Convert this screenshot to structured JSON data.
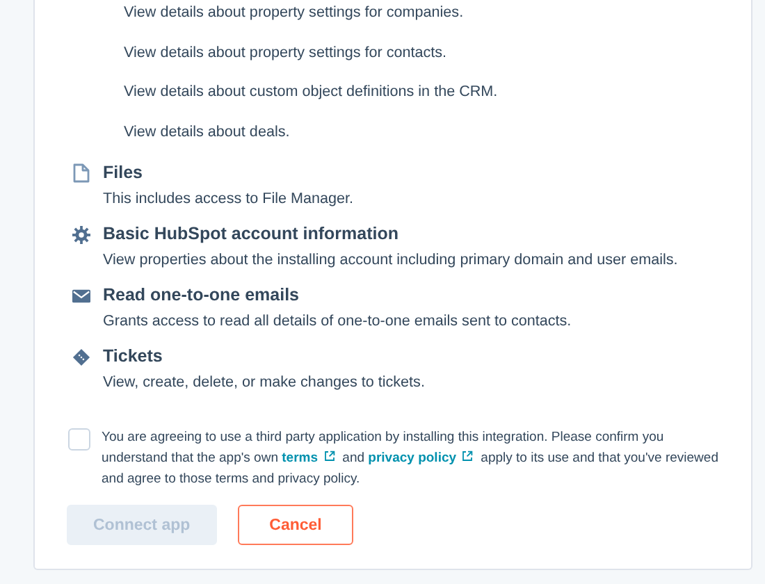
{
  "scope_details": [
    "View details about property settings for companies.",
    "View details about property settings for contacts.",
    "View details about custom object definitions in the CRM.",
    "View details about deals."
  ],
  "permissions": [
    {
      "title": "Files",
      "description": "This includes access to File Manager."
    },
    {
      "title": "Basic HubSpot account information",
      "description": "View properties about the installing account including primary domain and user emails."
    },
    {
      "title": "Read one-to-one emails",
      "description": "Grants access to read all details of one-to-one emails sent to contacts."
    },
    {
      "title": "Tickets",
      "description": "View, create, delete, or make changes to tickets."
    }
  ],
  "consent": {
    "checked": false,
    "parts": [
      {
        "kind": "text",
        "text": "You are agreeing to use a third party application by installing this integration. Please confirm you understand that the app's own "
      },
      {
        "kind": "link",
        "text": "terms"
      },
      {
        "kind": "text",
        "text": " and "
      },
      {
        "kind": "link",
        "text": "privacy policy"
      },
      {
        "kind": "text",
        "text": " apply to its use and that you've reviewed and agree to those terms and privacy policy."
      }
    ]
  },
  "buttons": [
    {
      "label": "Connect app",
      "kind": "primary",
      "disabled": true
    },
    {
      "label": "Cancel",
      "kind": "secondary",
      "disabled": false
    }
  ]
}
